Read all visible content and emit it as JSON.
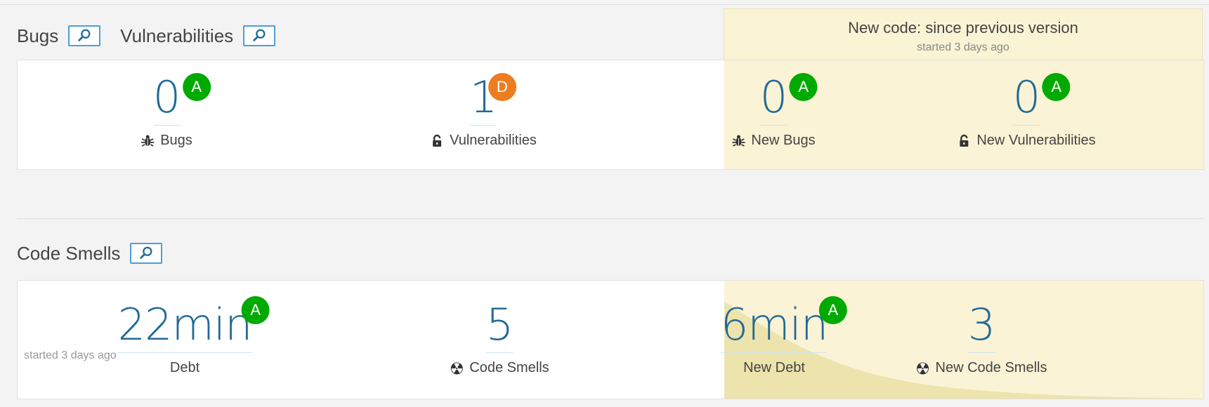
{
  "colors": {
    "rating_a": "#00aa00",
    "rating_d": "#ed7d20",
    "measure_value": "#236a97",
    "leak_background": "#fbf3d5"
  },
  "issues_section": {
    "headers": [
      {
        "label": "Bugs",
        "icon": "link-icon"
      },
      {
        "label": "Vulnerabilities",
        "icon": "link-icon"
      }
    ],
    "new_code": {
      "title": "New code: since previous version",
      "subtitle": "started 3 days ago"
    },
    "overall": [
      {
        "value": "0",
        "rating": "A",
        "label": "Bugs",
        "icon": "bug-icon"
      },
      {
        "value": "1",
        "rating": "D",
        "label": "Vulnerabilities",
        "icon": "lock-icon"
      }
    ],
    "new": [
      {
        "value": "0",
        "rating": "A",
        "label": "New Bugs",
        "icon": "bug-icon"
      },
      {
        "value": "0",
        "rating": "A",
        "label": "New Vulnerabilities",
        "icon": "lock-icon"
      }
    ]
  },
  "code_smells_section": {
    "header": {
      "label": "Code Smells",
      "icon": "link-icon"
    },
    "overall": [
      {
        "value": "22min",
        "rating": "A",
        "label": "Debt"
      },
      {
        "value": "5",
        "label": "Code Smells",
        "icon": "code-smell-icon"
      }
    ],
    "new": [
      {
        "value": "6min",
        "rating": "A",
        "label": "New Debt"
      },
      {
        "value": "3",
        "label": "New Code Smells",
        "icon": "code-smell-icon"
      }
    ],
    "footnote": "started 3 days ago"
  }
}
